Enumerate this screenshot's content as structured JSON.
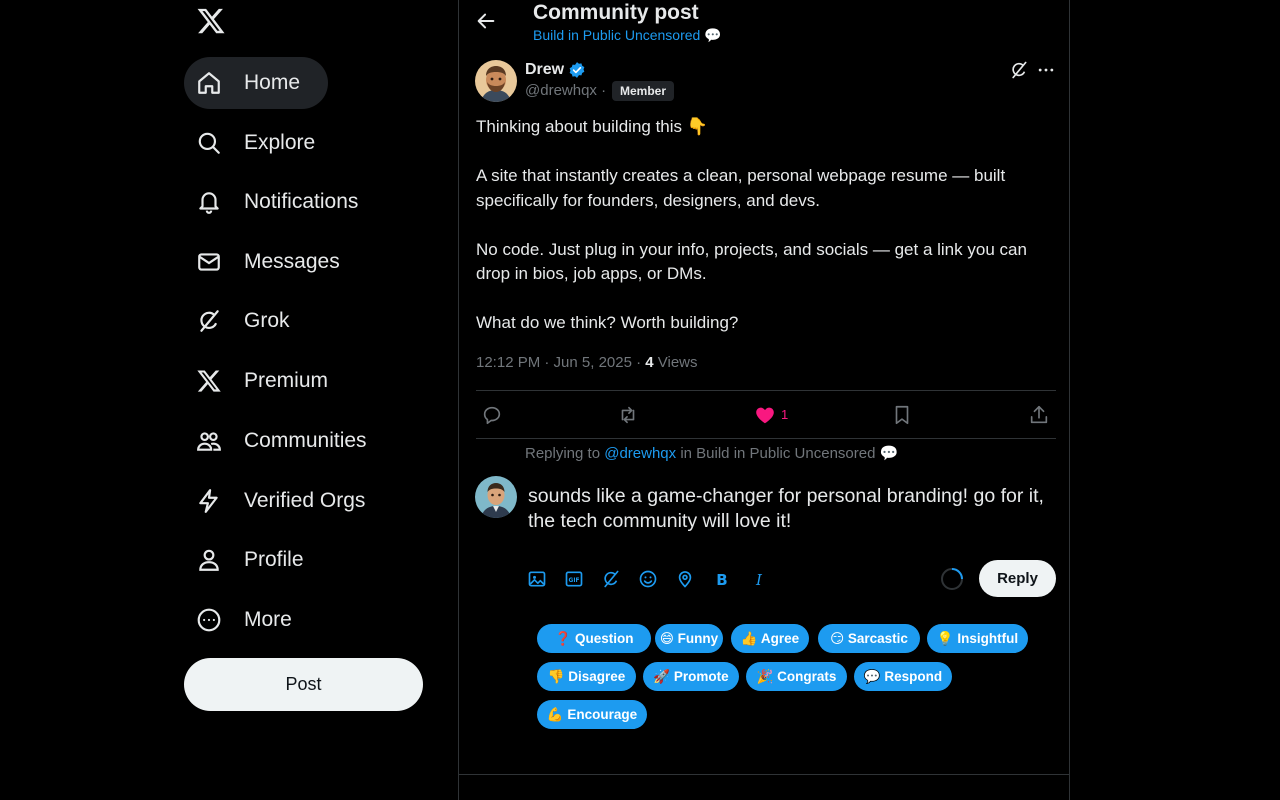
{
  "sidebar": {
    "logo": "x-logo-icon",
    "items": [
      {
        "label": "Home",
        "icon": "home-icon"
      },
      {
        "label": "Explore",
        "icon": "search-icon"
      },
      {
        "label": "Notifications",
        "icon": "bell-icon"
      },
      {
        "label": "Messages",
        "icon": "mail-icon"
      },
      {
        "label": "Grok",
        "icon": "grok-icon"
      },
      {
        "label": "Premium",
        "icon": "x-logo-icon"
      },
      {
        "label": "Communities",
        "icon": "communities-icon"
      },
      {
        "label": "Verified Orgs",
        "icon": "lightning-icon"
      },
      {
        "label": "Profile",
        "icon": "person-icon"
      },
      {
        "label": "More",
        "icon": "more-circle-icon"
      }
    ],
    "post_label": "Post"
  },
  "header": {
    "title": "Community post",
    "community": "Build in Public Uncensored 💬"
  },
  "post": {
    "author_name": "Drew",
    "handle": "@drewhqx ·",
    "badge": "Member",
    "body": [
      "Thinking about building this 👇",
      "A site that instantly creates a clean, personal webpage resume — built specifically for founders, designers, and devs.",
      "No code. Just plug in your info, projects, and socials — get a link you can drop in bios, job apps, or DMs.",
      "What do we think? Worth building?"
    ],
    "timestamp": "12:12 PM · Jun 5, 2025 · ",
    "views_count": "4",
    "views_label": " Views",
    "likes": "1"
  },
  "reply": {
    "context_prefix": "Replying to ",
    "context_handle": "@drewhqx",
    "context_suffix": " in Build in Public Uncensored 💬",
    "text": "sounds like a game-changer for personal branding! go for it, the tech community will love it!",
    "button_label": "Reply"
  },
  "tone_chips": [
    "❓ Question",
    "😄 Funny",
    "👍 Agree",
    "😏 Sarcastic",
    "💡 Insightful",
    "👎 Disagree",
    "🚀 Promote",
    "🎉 Congrats",
    "💬 Respond",
    "💪 Encourage"
  ],
  "colors": {
    "accent": "#1d9bf0",
    "like": "#f91880",
    "background": "#000000",
    "muted": "#71767b"
  }
}
